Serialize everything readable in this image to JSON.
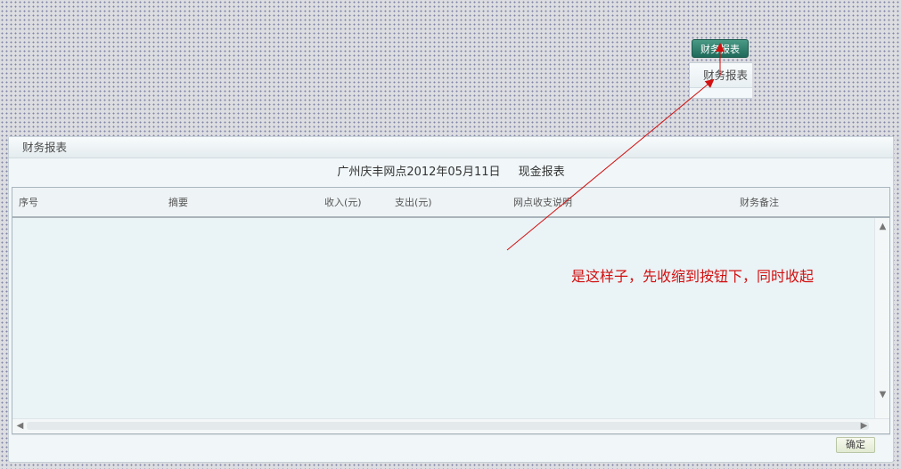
{
  "top_button": {
    "label": "财务报表"
  },
  "mini_panel": {
    "title": "财务报表"
  },
  "panel": {
    "title": "财务报表",
    "report_title": {
      "branch_date": "广州庆丰网点2012年05月11日",
      "report_type": "现金报表"
    },
    "grid": {
      "columns": [
        "序号",
        "摘要",
        "收入(元)",
        "支出(元)",
        "网点收支说明",
        "财务备注"
      ],
      "rows": []
    },
    "footer": {
      "ok_label": "确定"
    }
  },
  "annotation": {
    "text": "是这样子，先收缩到按钮下，同时收起",
    "color": "#d31010"
  },
  "scroll_icons": {
    "up": "▲",
    "down": "▼",
    "left": "◀",
    "right": "▶"
  }
}
